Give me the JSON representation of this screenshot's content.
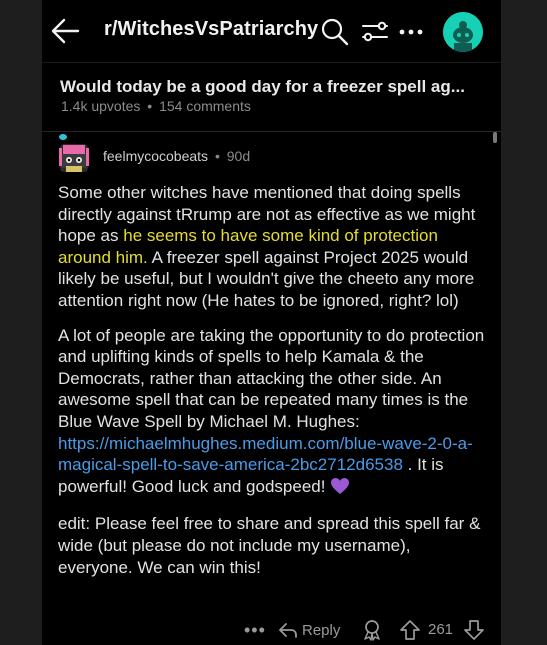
{
  "header": {
    "subreddit": "r/WitchesVsPatriarchy",
    "icons": [
      "back-arrow-icon",
      "search-icon",
      "filter-icon",
      "more-icon",
      "avatar"
    ]
  },
  "post": {
    "title": "Would today be a good day for a freezer spell ag...",
    "upvotes": "1.4k upvotes",
    "separator": "•",
    "comments": "154 comments"
  },
  "comment": {
    "username": "feelmycocobeats",
    "separator": "•",
    "age": "90d",
    "p1_a": "Some other witches have mentioned that doing spells directly against tRrump are not as effective as we might hope as ",
    "p1_highlight": "he seems to have some kind of protection around him.",
    "p1_b": " A freezer spell against Project 2025 would likely be useful, but I wouldn't give the cheeto any more attention right now (He hates to be ignored, right? lol)",
    "p2_a": "A lot of people are taking the opportunity to do protection and uplifting kinds of spells to help Kamala & the Democrats, rather than attacking the other side. An awesome spell that can be repeated many times is the Blue Wave Spell by Michael M. Hughes: ",
    "p2_link": "https://michaelmhughes.medium.com/blue-wave-2-0-a-magical-spell-to-save-america-2bc2712d6538",
    "p2_b": " . It is powerful! Good luck and godspeed! ",
    "p2_emoji": "purple-heart-icon",
    "p3": "edit: Please feel free to share and spread this spell far & wide (but please do not include my username), everyone. We can win this!"
  },
  "actions": {
    "more": "•••",
    "reply": "Reply",
    "vote_count": "261"
  },
  "colors": {
    "background": "#000000",
    "highlight": "#e6dc2e",
    "link": "#4a9be8",
    "avatar_teal": "#17d1b5",
    "heart": "#9b59d6"
  }
}
